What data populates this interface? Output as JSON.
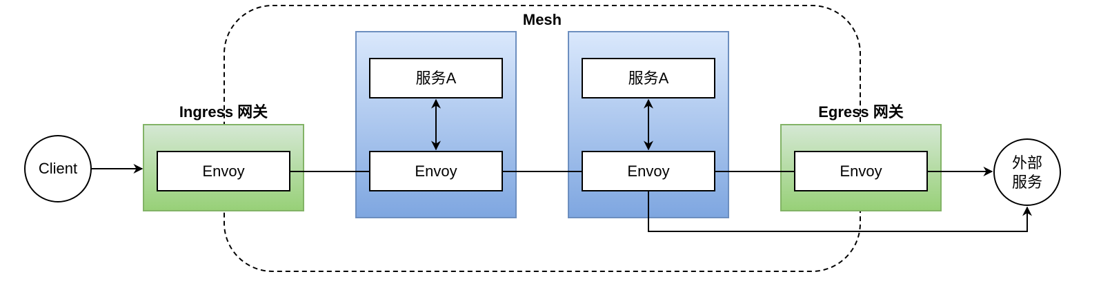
{
  "diagram": {
    "mesh": {
      "label": "Mesh"
    },
    "ingress": {
      "label": "Ingress 网关",
      "proxy": "Envoy"
    },
    "service1": {
      "app": "服务A",
      "proxy": "Envoy"
    },
    "service2": {
      "app": "服务A",
      "proxy": "Envoy"
    },
    "egress": {
      "label": "Egress 网关",
      "proxy": "Envoy"
    },
    "client": {
      "label": "Client"
    },
    "external": {
      "line1": "外部",
      "line2": "服务"
    }
  },
  "colors": {
    "gateway_fill_top": "#d5e8d4",
    "gateway_fill_bottom": "#97d077",
    "gateway_stroke": "#82b366",
    "service_fill_top": "#dae8fc",
    "service_fill_bottom": "#7ea6e0",
    "service_stroke": "#6c8ebf",
    "line": "#000000"
  }
}
